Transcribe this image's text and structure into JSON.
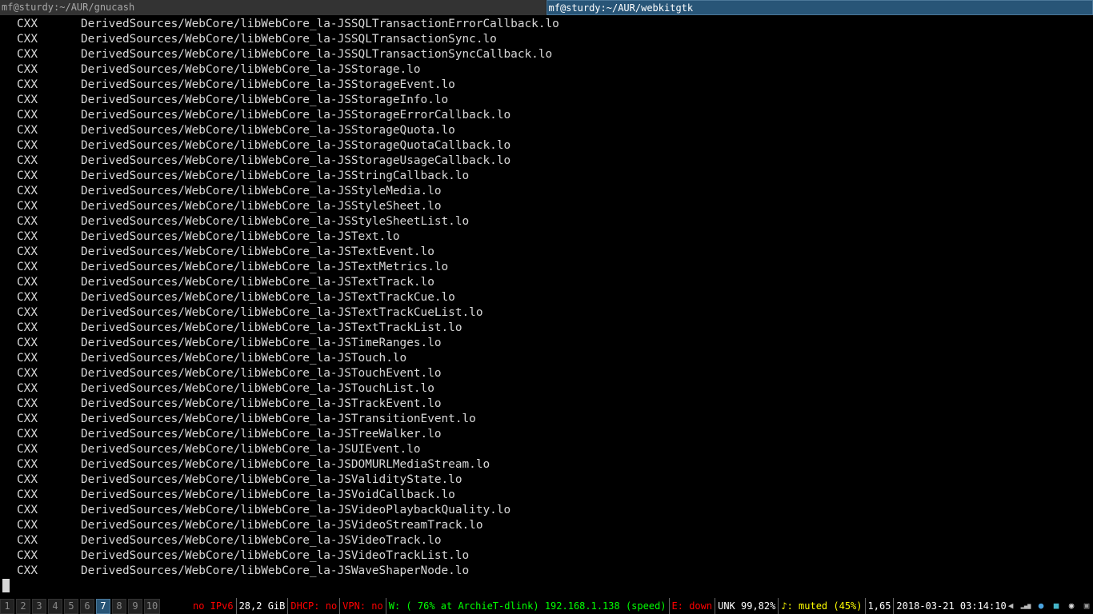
{
  "titlebar": {
    "tabs": [
      {
        "label": "mf@sturdy:~/AUR/gnucash",
        "active": false
      },
      {
        "label": "mf@sturdy:~/AUR/webkitgtk",
        "active": true
      }
    ]
  },
  "terminal": {
    "lines": [
      {
        "tag": "CXX",
        "path": "DerivedSources/WebCore/libWebCore_la-JSSQLTransactionErrorCallback.lo"
      },
      {
        "tag": "CXX",
        "path": "DerivedSources/WebCore/libWebCore_la-JSSQLTransactionSync.lo"
      },
      {
        "tag": "CXX",
        "path": "DerivedSources/WebCore/libWebCore_la-JSSQLTransactionSyncCallback.lo"
      },
      {
        "tag": "CXX",
        "path": "DerivedSources/WebCore/libWebCore_la-JSStorage.lo"
      },
      {
        "tag": "CXX",
        "path": "DerivedSources/WebCore/libWebCore_la-JSStorageEvent.lo"
      },
      {
        "tag": "CXX",
        "path": "DerivedSources/WebCore/libWebCore_la-JSStorageInfo.lo"
      },
      {
        "tag": "CXX",
        "path": "DerivedSources/WebCore/libWebCore_la-JSStorageErrorCallback.lo"
      },
      {
        "tag": "CXX",
        "path": "DerivedSources/WebCore/libWebCore_la-JSStorageQuota.lo"
      },
      {
        "tag": "CXX",
        "path": "DerivedSources/WebCore/libWebCore_la-JSStorageQuotaCallback.lo"
      },
      {
        "tag": "CXX",
        "path": "DerivedSources/WebCore/libWebCore_la-JSStorageUsageCallback.lo"
      },
      {
        "tag": "CXX",
        "path": "DerivedSources/WebCore/libWebCore_la-JSStringCallback.lo"
      },
      {
        "tag": "CXX",
        "path": "DerivedSources/WebCore/libWebCore_la-JSStyleMedia.lo"
      },
      {
        "tag": "CXX",
        "path": "DerivedSources/WebCore/libWebCore_la-JSStyleSheet.lo"
      },
      {
        "tag": "CXX",
        "path": "DerivedSources/WebCore/libWebCore_la-JSStyleSheetList.lo"
      },
      {
        "tag": "CXX",
        "path": "DerivedSources/WebCore/libWebCore_la-JSText.lo"
      },
      {
        "tag": "CXX",
        "path": "DerivedSources/WebCore/libWebCore_la-JSTextEvent.lo"
      },
      {
        "tag": "CXX",
        "path": "DerivedSources/WebCore/libWebCore_la-JSTextMetrics.lo"
      },
      {
        "tag": "CXX",
        "path": "DerivedSources/WebCore/libWebCore_la-JSTextTrack.lo"
      },
      {
        "tag": "CXX",
        "path": "DerivedSources/WebCore/libWebCore_la-JSTextTrackCue.lo"
      },
      {
        "tag": "CXX",
        "path": "DerivedSources/WebCore/libWebCore_la-JSTextTrackCueList.lo"
      },
      {
        "tag": "CXX",
        "path": "DerivedSources/WebCore/libWebCore_la-JSTextTrackList.lo"
      },
      {
        "tag": "CXX",
        "path": "DerivedSources/WebCore/libWebCore_la-JSTimeRanges.lo"
      },
      {
        "tag": "CXX",
        "path": "DerivedSources/WebCore/libWebCore_la-JSTouch.lo"
      },
      {
        "tag": "CXX",
        "path": "DerivedSources/WebCore/libWebCore_la-JSTouchEvent.lo"
      },
      {
        "tag": "CXX",
        "path": "DerivedSources/WebCore/libWebCore_la-JSTouchList.lo"
      },
      {
        "tag": "CXX",
        "path": "DerivedSources/WebCore/libWebCore_la-JSTrackEvent.lo"
      },
      {
        "tag": "CXX",
        "path": "DerivedSources/WebCore/libWebCore_la-JSTransitionEvent.lo"
      },
      {
        "tag": "CXX",
        "path": "DerivedSources/WebCore/libWebCore_la-JSTreeWalker.lo"
      },
      {
        "tag": "CXX",
        "path": "DerivedSources/WebCore/libWebCore_la-JSUIEvent.lo"
      },
      {
        "tag": "CXX",
        "path": "DerivedSources/WebCore/libWebCore_la-JSDOMURLMediaStream.lo"
      },
      {
        "tag": "CXX",
        "path": "DerivedSources/WebCore/libWebCore_la-JSValidityState.lo"
      },
      {
        "tag": "CXX",
        "path": "DerivedSources/WebCore/libWebCore_la-JSVoidCallback.lo"
      },
      {
        "tag": "CXX",
        "path": "DerivedSources/WebCore/libWebCore_la-JSVideoPlaybackQuality.lo"
      },
      {
        "tag": "CXX",
        "path": "DerivedSources/WebCore/libWebCore_la-JSVideoStreamTrack.lo"
      },
      {
        "tag": "CXX",
        "path": "DerivedSources/WebCore/libWebCore_la-JSVideoTrack.lo"
      },
      {
        "tag": "CXX",
        "path": "DerivedSources/WebCore/libWebCore_la-JSVideoTrackList.lo"
      },
      {
        "tag": "CXX",
        "path": "DerivedSources/WebCore/libWebCore_la-JSWaveShaperNode.lo"
      }
    ]
  },
  "workspaces": [
    {
      "label": "1",
      "focused": false
    },
    {
      "label": "2",
      "focused": false
    },
    {
      "label": "3",
      "focused": false
    },
    {
      "label": "4",
      "focused": false
    },
    {
      "label": "5",
      "focused": false
    },
    {
      "label": "6",
      "focused": false
    },
    {
      "label": "7",
      "focused": true
    },
    {
      "label": "8",
      "focused": false
    },
    {
      "label": "9",
      "focused": false
    },
    {
      "label": "10",
      "focused": false
    }
  ],
  "status": {
    "ipv6": "no IPv6",
    "disk": "28,2 GiB",
    "dhcp": "DHCP: no",
    "vpn": "VPN: no",
    "wifi": "W: ( 76% at ArchieT-dlink) 192.168.1.138 (speed)",
    "ethernet": "E: down",
    "battery": "UNK 99,82%",
    "volume": "♪: muted (45%)",
    "load": "1,65",
    "datetime": "2018-03-21 03:14:10"
  },
  "tray": [
    {
      "name": "volume-tray-icon",
      "glyph": "◀",
      "color": "#bbbbbb"
    },
    {
      "name": "network-signal-tray-icon",
      "glyph": "▂▄▆",
      "color": "#bbbbbb"
    },
    {
      "name": "update-tray-icon",
      "glyph": "●",
      "color": "#4aa3df"
    },
    {
      "name": "app-tray-icon",
      "glyph": "■",
      "color": "#45b6c9"
    },
    {
      "name": "discord-tray-icon",
      "glyph": "◉",
      "color": "#dddddd"
    },
    {
      "name": "window-tray-icon",
      "glyph": "▣",
      "color": "#999999"
    }
  ],
  "colors": {
    "focused_ws_bg": "#285577",
    "focused_ws_border": "#4c7899",
    "status_bad": "#ff0000",
    "status_good": "#00ff00",
    "status_warn": "#ffff00"
  }
}
